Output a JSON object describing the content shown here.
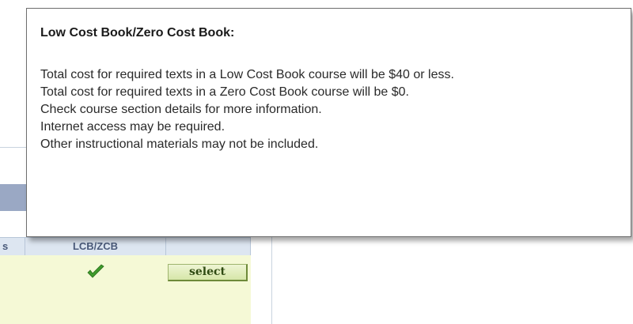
{
  "tooltip": {
    "title": "Low Cost Book/Zero Cost Book:",
    "lines": [
      "Total cost for required texts in a Low Cost Book course will be $40 or less.",
      "Total cost for required texts in a Zero Cost Book course will be $0.",
      "Check course section details for more information.",
      "Internet access may be required.",
      "Other instructional materials may not be included."
    ]
  },
  "grid": {
    "columns": [
      "s",
      "LCB/ZCB",
      ""
    ],
    "row": {
      "lcb_zcb_icon": "check-icon",
      "select_label": "select"
    }
  },
  "colors": {
    "check_green": "#3f9b2c",
    "row_background": "#f5f9d6",
    "header_background": "#dde6f1"
  }
}
